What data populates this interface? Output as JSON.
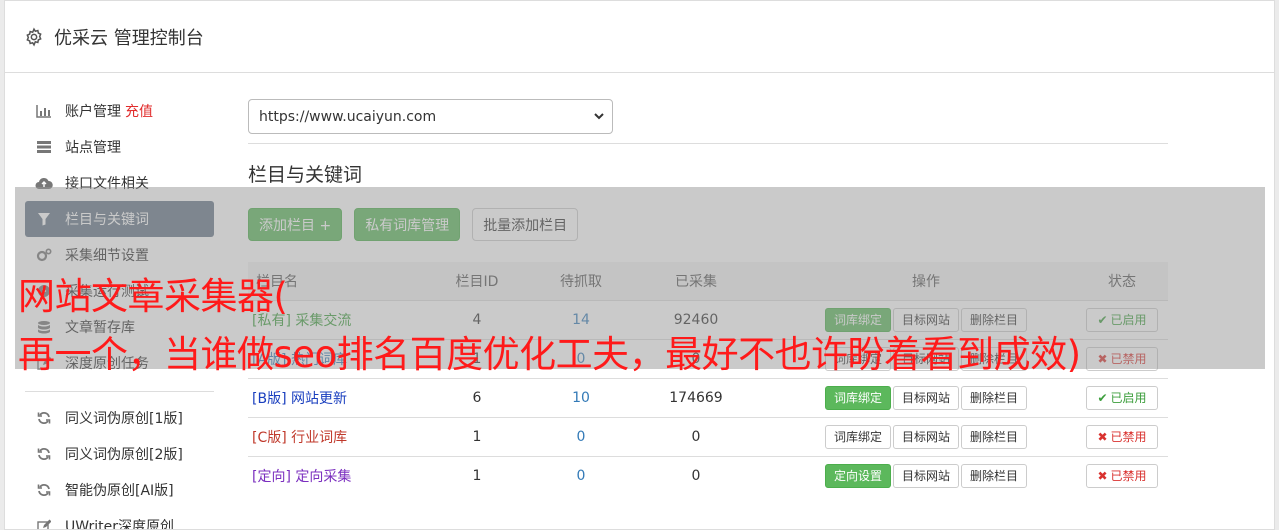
{
  "header": {
    "title": "优采云 管理控制台"
  },
  "sidebar": {
    "items": [
      {
        "label": "账户管理",
        "tag": "充值",
        "icon": "bar-chart-icon"
      },
      {
        "label": "站点管理",
        "icon": "server-icon"
      },
      {
        "label": "接口文件相关",
        "icon": "cloud-upload-icon"
      },
      {
        "label": "栏目与关键词",
        "icon": "filter-icon",
        "active": true
      },
      {
        "label": "采集细节设置",
        "icon": "cogs-icon"
      },
      {
        "label": "采集运行测试",
        "icon": "play-icon"
      },
      {
        "label": "文章暂存库",
        "icon": "database-icon"
      },
      {
        "label": "深度原创任务",
        "icon": "edit-icon"
      }
    ],
    "items2": [
      {
        "label": "同义词伪原创[1版]",
        "icon": "refresh-icon"
      },
      {
        "label": "同义词伪原创[2版]",
        "icon": "refresh-icon"
      },
      {
        "label": "智能伪原创[AI版]",
        "icon": "refresh-icon"
      },
      {
        "label": "UWriter深度原创",
        "icon": "pencil-icon"
      }
    ]
  },
  "main": {
    "site_select": "https://www.ucaiyun.com",
    "section_title": "栏目与关键词",
    "buttons": {
      "add": "添加栏目 +",
      "private": "私有词库管理",
      "batch": "批量添加栏目"
    },
    "table": {
      "headers": {
        "name": "栏目名",
        "id": "栏目ID",
        "pending": "待抓取",
        "collected": "已采集",
        "ops": "操作",
        "status": "状态"
      },
      "rows": [
        {
          "tag": "[私有]",
          "name": "采集交流",
          "id": "4",
          "pending": "14",
          "collected": "92460",
          "op1": "词库绑定",
          "op2": "目标网站",
          "op3": "删除栏目",
          "status": "已启用",
          "tagColor": "#3c9e3c"
        },
        {
          "tag": "[A版]",
          "name": "热门词库",
          "id": "1",
          "pending": "0",
          "collected": "0",
          "op1": "词库绑定",
          "op2": "目标网站",
          "op3": "删除栏目",
          "status": "已禁用",
          "tagColor": "#337ab7"
        },
        {
          "tag": "[B版]",
          "name": "网站更新",
          "id": "6",
          "pending": "10",
          "collected": "174669",
          "op1": "词库绑定",
          "op2": "目标网站",
          "op3": "删除栏目",
          "status": "已启用",
          "tagColor": "#1a3fbf"
        },
        {
          "tag": "[C版]",
          "name": "行业词库",
          "id": "1",
          "pending": "0",
          "collected": "0",
          "op1": "词库绑定",
          "op2": "目标网站",
          "op3": "删除栏目",
          "status": "已禁用",
          "tagColor": "#c0392b"
        },
        {
          "tag": "[定向]",
          "name": "定向采集",
          "id": "1",
          "pending": "0",
          "collected": "0",
          "op1": "定向设置",
          "op2": "目标网站",
          "op3": "删除栏目",
          "status": "已禁用",
          "tagColor": "#7b2fbf"
        }
      ]
    }
  },
  "watermark": {
    "line1": "网站文章采集器(",
    "line2": "再一个，当谁做seo排名百度优化工夫，最好不也许盼着看到成效)"
  },
  "colors": {
    "accent_green": "#5cb85c",
    "active_nav": "#667788",
    "watermark": "#ff1a1a"
  }
}
